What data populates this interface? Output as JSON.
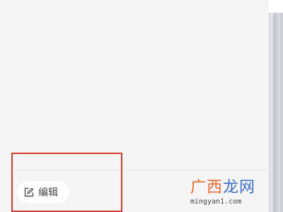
{
  "edit_button": {
    "label": "编辑",
    "icon": "edit-square-icon"
  },
  "watermark": {
    "brand_part_1": "广西",
    "brand_part_2": "龙网",
    "url": "mingyan1.com",
    "colors": {
      "part_1": "#e36a2e",
      "part_2": "#3f6ec8"
    }
  },
  "highlight": {
    "color": "#d63b2f"
  }
}
